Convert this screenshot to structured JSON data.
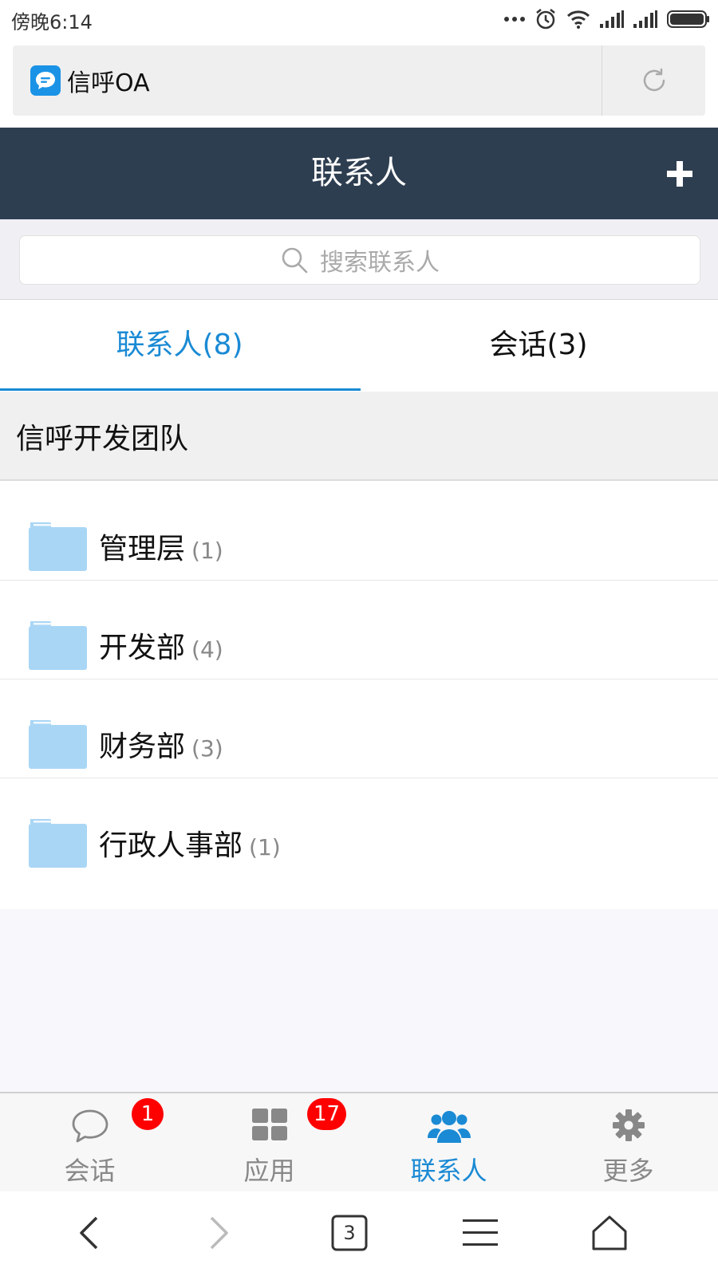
{
  "status_bar": {
    "time": "傍晚6:14"
  },
  "browser": {
    "title": "信呼OA"
  },
  "header": {
    "title": "联系人"
  },
  "search": {
    "placeholder": "搜索联系人"
  },
  "tabs": [
    {
      "label": "联系人(8)",
      "active": true
    },
    {
      "label": "会话(3)",
      "active": false
    }
  ],
  "group": {
    "title": "信呼开发团队"
  },
  "departments": [
    {
      "name": "管理层",
      "count": "(1)"
    },
    {
      "name": "开发部",
      "count": "(4)"
    },
    {
      "name": "财务部",
      "count": "(3)"
    },
    {
      "name": "行政人事部",
      "count": "(1)"
    }
  ],
  "tabbar": [
    {
      "label": "会话",
      "icon": "chat-bubble-icon",
      "badge": "1",
      "active": false
    },
    {
      "label": "应用",
      "icon": "apps-grid-icon",
      "badge": "17",
      "active": false
    },
    {
      "label": "联系人",
      "icon": "users-icon",
      "badge": "",
      "active": true
    },
    {
      "label": "更多",
      "icon": "gear-icon",
      "badge": "",
      "active": false
    }
  ],
  "browser_nav": {
    "tab_count": "3"
  },
  "colors": {
    "header_bg": "#2e3e51",
    "accent": "#1a8ad4",
    "badge": "#ff0000",
    "folder": "#a9d6f5"
  }
}
